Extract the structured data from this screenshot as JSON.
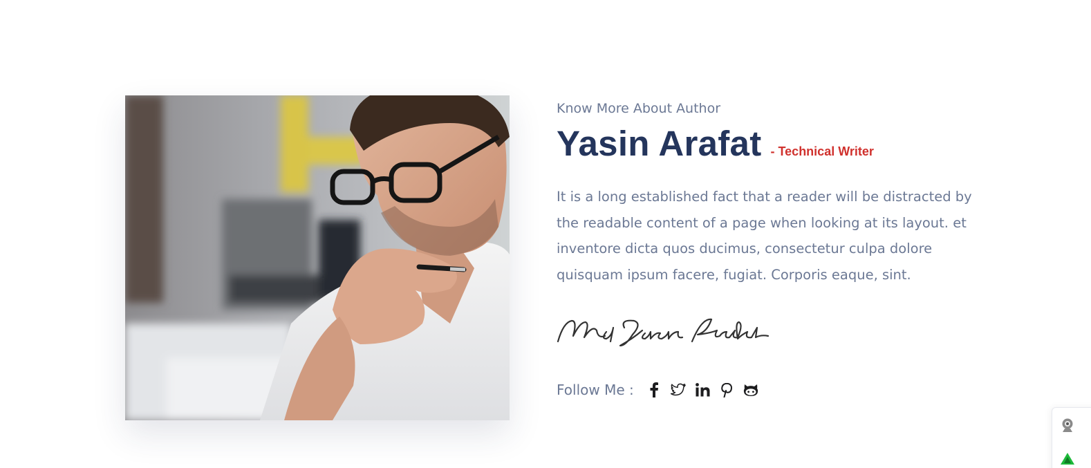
{
  "author": {
    "eyebrow": "Know More About Author",
    "name": "Yasin Arafat",
    "role": "- Technical Writer",
    "bio": "It is a long established fact that a reader will be distracted by the readable content of a page when looking at its layout. et inventore dicta quos ducimus, consectetur culpa dolore quisquam ipsum facere, fugiat. Corporis eaque, sint.",
    "signature_text": "Md Yasin Arafat"
  },
  "follow": {
    "label": "Follow Me :",
    "icons": [
      "facebook-icon",
      "twitter-icon",
      "linkedin-icon",
      "pinterest-icon",
      "github-icon"
    ]
  },
  "colors": {
    "heading": "#24355c",
    "accent": "#d0312d",
    "body_text": "#6b7894",
    "icon": "#1d1d1f"
  }
}
